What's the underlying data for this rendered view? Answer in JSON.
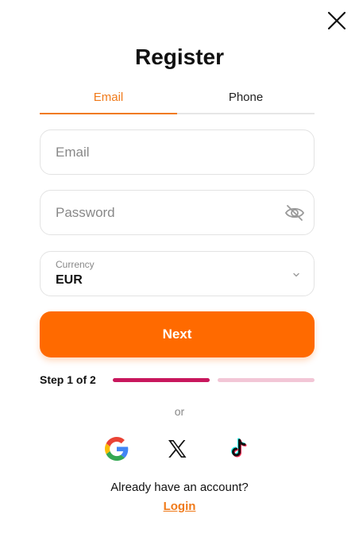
{
  "dialog": {
    "title": "Register"
  },
  "tabs": [
    {
      "label": "Email",
      "active": true
    },
    {
      "label": "Phone",
      "active": false
    }
  ],
  "form": {
    "email": {
      "placeholder": "Email",
      "value": ""
    },
    "password": {
      "placeholder": "Password",
      "value": "",
      "toggle_icon": "eye-slash-icon"
    },
    "currency": {
      "label": "Currency",
      "value": "EUR",
      "chevron_icon": "chevron-down-icon"
    }
  },
  "next_button": {
    "label": "Next"
  },
  "progress": {
    "text": "Step 1 of 2",
    "current_step": 1,
    "total_steps": 2
  },
  "separator": {
    "text": "or"
  },
  "social_logins": [
    {
      "name": "google",
      "icon": "google-icon"
    },
    {
      "name": "x",
      "icon": "x-icon"
    },
    {
      "name": "tiktok",
      "icon": "tiktok-icon"
    }
  ],
  "footer": {
    "prompt": "Already have an account?",
    "login_label": "Login"
  },
  "colors": {
    "accent": "#f07a1a",
    "primary_button": "#ff6a00",
    "progress_done": "#c8175d",
    "progress_todo": "#f2c6d6"
  }
}
